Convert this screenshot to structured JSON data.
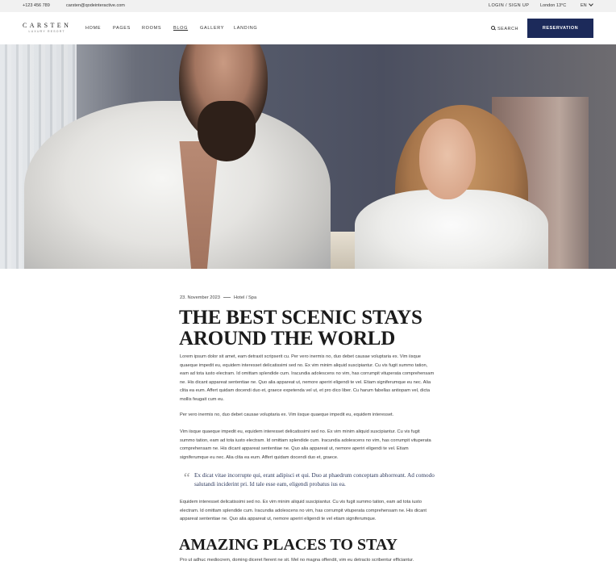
{
  "topbar": {
    "phone": "+123 456 789",
    "email": "carsten@qodeinteractive.com",
    "login": "LOGIN / SIGN UP",
    "weather": "London  13°C",
    "language": "EN"
  },
  "header": {
    "logo_name": "CARSTEN",
    "logo_tag": "LUXURY RESORT",
    "nav": [
      "HOME",
      "PAGES",
      "ROOMS",
      "BLOG",
      "GALLERY",
      "LANDING"
    ],
    "active_nav": "BLOG",
    "search_label": "SEARCH",
    "reservation_label": "RESERVATION"
  },
  "hero": {
    "image_alt": "chevron"
  },
  "article": {
    "date": "23. November 2023",
    "category": "Hotel / Spa",
    "title": "THE BEST SCENIC STAYS AROUND THE WORLD",
    "paragraph1": "Lorem ipsum dolor sit amet, eam detraxit scripserit cu. Per vero inermis no, duo debet causae voluptaria ex. Vim iisque quaeque impedit eu, equidem interesset delicatissimi sed no. Ex vim minim aliquid suscipiantur. Cu vis fugit summo tation, eam ad tota iusto electram. Id omittam splendide cum. Iracundia adolescens no vim, has corrumpit vituperata comprehensam ne. His dicant appareat sententiae ne. Quo alia appareat ut, nemore aperiri eligendi te vel. Etiam signiferumque eu nec. Alia clita ea eum. Affert quidam docendi duo et, graece expetenda vel ut, et pro dico liber. Cu harum fabellas antiopam vel, dicta mollis feugait cum eu.",
    "paragraph2": "Per vero inermis no, duo debet causae voluptaria ex. Vim iisque quaeque impedit eu, equidem interesset.",
    "paragraph3": "Vim iisque quaeque impedit eu, equidem interesset delicatissimi sed no. Ex vim minim aliquid suscipiantur. Cu vis fugit summo tation, eam ad tota iusto electram. Id omittam splendide cum. Iracundia adolescens no vim, has corrumpit vituperata comprehensam ne. His dicant appareat sententiae ne. Quo alia appareat ut, nemore aperiri eligendi te vel. Etiam signiferumque eu nec. Alia clita ea eum. Affert quidam docendi duo et, graece.",
    "quote": "Ex dicat vitae incorrupte qui, erant adipisci et qui. Duo at phaedrum conceptam abhorreant. Ad comodo salutandi inciderint pri. Id tale esse eam, eligendi probatus ius ea.",
    "paragraph4": "Equidem interesset delicatissimi sed no. Ex vim minim aliquid suscipiantur. Cu vis fugit summo tation, eam ad tota iusto electram. Id omittam splendide cum. Iracundia adolescens no vim, has corrumpit vituperata comprehensam ne. His dicant appareat sententiae ne. Quo alia appareat ut, nemore aperiri eligendi te vel etiam signiferumque.",
    "heading2": "AMAZING PLACES TO STAY",
    "paragraph5": "Pro ut adhuc mediocrem, doming diceret fierent ne sit. Mel no magna offendit, vim eu detracto scribentur efficiantur."
  }
}
